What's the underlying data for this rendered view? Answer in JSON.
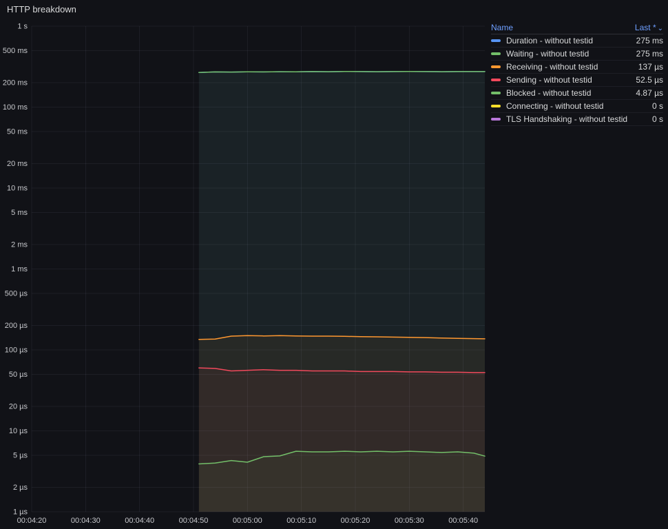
{
  "panel": {
    "title": "HTTP breakdown"
  },
  "legend": {
    "header": {
      "name": "Name",
      "last": "Last *",
      "caret": "⌄"
    },
    "last_values": [
      "275 ms",
      "275 ms",
      "137 µs",
      "52.5 µs",
      "4.87 µs",
      "0 s",
      "0 s"
    ]
  },
  "chart_data": {
    "type": "line",
    "title": "HTTP breakdown",
    "legend_position": "right-table",
    "grid": true,
    "x_axis": {
      "tick_labels": [
        "00:04:20",
        "00:04:30",
        "00:04:40",
        "00:04:50",
        "00:05:00",
        "00:05:10",
        "00:05:20",
        "00:05:30",
        "00:05:40"
      ],
      "tick_seconds": [
        260,
        270,
        280,
        290,
        300,
        310,
        320,
        330,
        340
      ],
      "range_seconds": [
        260,
        344
      ]
    },
    "y_axis": {
      "scale": "log",
      "unit": "duration (seconds)",
      "tick_labels": [
        "1 s",
        "500 ms",
        "200 ms",
        "100 ms",
        "50 ms",
        "20 ms",
        "10 ms",
        "5 ms",
        "2 ms",
        "1 ms",
        "500 µs",
        "200 µs",
        "100 µs",
        "50 µs",
        "20 µs",
        "10 µs",
        "5 µs",
        "2 µs",
        "1 µs"
      ],
      "tick_values": [
        1,
        0.5,
        0.2,
        0.1,
        0.05,
        0.02,
        0.01,
        0.005,
        0.002,
        0.001,
        0.0005,
        0.0002,
        0.0001,
        5e-05,
        2e-05,
        1e-05,
        5e-06,
        2e-06,
        1e-06
      ],
      "range": [
        1e-06,
        1
      ]
    },
    "x_seconds": [
      291,
      294,
      297,
      300,
      303,
      306,
      309,
      312,
      315,
      318,
      321,
      324,
      327,
      330,
      333,
      336,
      339,
      342,
      344
    ],
    "series": [
      {
        "name": "Duration - without testid",
        "color": "#5794F2",
        "values_s": [
          0.268,
          0.272,
          0.271,
          0.273,
          0.272,
          0.274,
          0.273,
          0.275,
          0.274,
          0.276,
          0.275,
          0.274,
          0.275,
          0.276,
          0.275,
          0.274,
          0.275,
          0.275,
          0.275
        ]
      },
      {
        "name": "Waiting - without testid",
        "color": "#73BF69",
        "values_s": [
          0.268,
          0.272,
          0.271,
          0.273,
          0.272,
          0.274,
          0.273,
          0.275,
          0.274,
          0.276,
          0.275,
          0.274,
          0.275,
          0.276,
          0.275,
          0.274,
          0.275,
          0.275,
          0.275
        ]
      },
      {
        "name": "Receiving - without testid",
        "color": "#FF9830",
        "values_s": [
          0.000135,
          0.000136,
          0.000148,
          0.00015,
          0.000149,
          0.00015,
          0.000149,
          0.000148,
          0.000148,
          0.000147,
          0.000146,
          0.000145,
          0.000144,
          0.000143,
          0.000142,
          0.00014,
          0.000139,
          0.000138,
          0.000137
        ]
      },
      {
        "name": "Sending - without testid",
        "color": "#F2495C",
        "values_s": [
          6e-05,
          5.9e-05,
          5.5e-05,
          5.6e-05,
          5.7e-05,
          5.6e-05,
          5.6e-05,
          5.5e-05,
          5.5e-05,
          5.5e-05,
          5.4e-05,
          5.4e-05,
          5.4e-05,
          5.35e-05,
          5.35e-05,
          5.3e-05,
          5.3e-05,
          5.25e-05,
          5.25e-05
        ]
      },
      {
        "name": "Blocked - without testid",
        "color": "#73BF69",
        "values_s": [
          3.9e-06,
          4e-06,
          4.3e-06,
          4.1e-06,
          4.8e-06,
          4.9e-06,
          5.6e-06,
          5.5e-06,
          5.5e-06,
          5.6e-06,
          5.5e-06,
          5.6e-06,
          5.5e-06,
          5.6e-06,
          5.5e-06,
          5.4e-06,
          5.5e-06,
          5.3e-06,
          4.87e-06
        ]
      },
      {
        "name": "Connecting - without testid",
        "color": "#FADE2A",
        "values_s": []
      },
      {
        "name": "TLS Handshaking - without testid",
        "color": "#B877D9",
        "values_s": []
      }
    ]
  }
}
